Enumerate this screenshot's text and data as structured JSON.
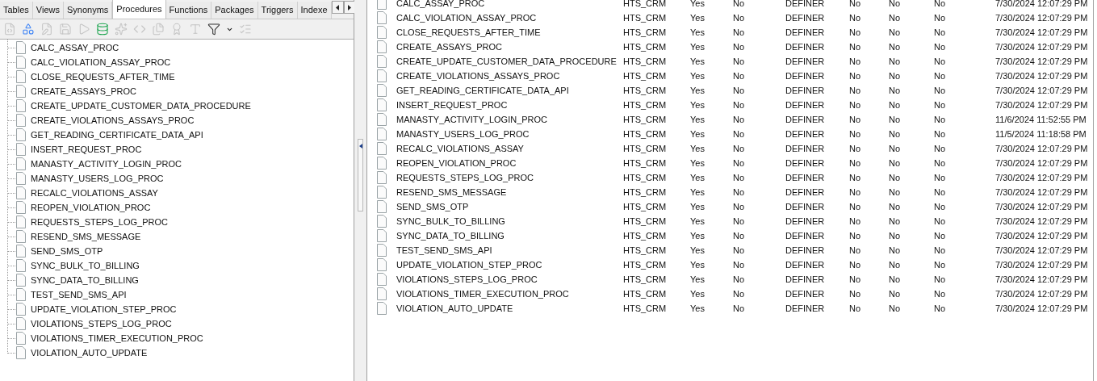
{
  "tabs": [
    {
      "label": "Tables",
      "selected": false
    },
    {
      "label": "Views",
      "selected": false
    },
    {
      "label": "Synonyms",
      "selected": false
    },
    {
      "label": "Procedures",
      "selected": true
    },
    {
      "label": "Functions",
      "selected": false
    },
    {
      "label": "Packages",
      "selected": false
    },
    {
      "label": "Triggers",
      "selected": false
    },
    {
      "label": "Indexe",
      "selected": false
    }
  ],
  "toolbar": [
    {
      "kind": "code",
      "disabled": true
    },
    {
      "kind": "shapes",
      "disabled": false
    },
    {
      "kind": "edit",
      "disabled": true
    },
    {
      "kind": "save",
      "disabled": true
    },
    {
      "kind": "play",
      "disabled": true
    },
    {
      "kind": "run",
      "disabled": false
    },
    {
      "kind": "sparkles",
      "disabled": true
    },
    {
      "kind": "sql",
      "disabled": true
    },
    {
      "kind": "files",
      "disabled": true
    },
    {
      "kind": "award",
      "disabled": true
    },
    {
      "kind": "text",
      "disabled": true
    },
    {
      "kind": "filter",
      "disabled": false
    },
    {
      "kind": "caret",
      "disabled": false
    },
    {
      "kind": "list",
      "disabled": true
    }
  ],
  "tree": {
    "items": [
      "CALC_ASSAY_PROC",
      "CALC_VIOLATION_ASSAY_PROC",
      "CLOSE_REQUESTS_AFTER_TIME",
      "CREATE_ASSAYS_PROC",
      "CREATE_UPDATE_CUSTOMER_DATA_PROCEDURE",
      "CREATE_VIOLATIONS_ASSAYS_PROC",
      "GET_READING_CERTIFICATE_DATA_API",
      "INSERT_REQUEST_PROC",
      "MANASTY_ACTIVITY_LOGIN_PROC",
      "MANASTY_USERS_LOG_PROC",
      "RECALC_VIOLATIONS_ASSAY",
      "REOPEN_VIOLATION_PROC",
      "REQUESTS_STEPS_LOG_PROC",
      "RESEND_SMS_MESSAGE",
      "SEND_SMS_OTP",
      "SYNC_BULK_TO_BILLING",
      "SYNC_DATA_TO_BILLING",
      "TEST_SEND_SMS_API",
      "UPDATE_VIOLATION_STEP_PROC",
      "VIOLATIONS_STEPS_LOG_PROC",
      "VIOLATIONS_TIMER_EXECUTION_PROC",
      "VIOLATION_AUTO_UPDATE"
    ]
  },
  "table": {
    "rows": [
      [
        "CALC_ASSAY_PROC",
        "HTS_CRM",
        "Yes",
        "No",
        "DEFINER",
        "No",
        "No",
        "No",
        "7/30/2024 12:07:29 PM"
      ],
      [
        "CALC_VIOLATION_ASSAY_PROC",
        "HTS_CRM",
        "Yes",
        "No",
        "DEFINER",
        "No",
        "No",
        "No",
        "7/30/2024 12:07:29 PM"
      ],
      [
        "CLOSE_REQUESTS_AFTER_TIME",
        "HTS_CRM",
        "Yes",
        "No",
        "DEFINER",
        "No",
        "No",
        "No",
        "7/30/2024 12:07:29 PM"
      ],
      [
        "CREATE_ASSAYS_PROC",
        "HTS_CRM",
        "Yes",
        "No",
        "DEFINER",
        "No",
        "No",
        "No",
        "7/30/2024 12:07:29 PM"
      ],
      [
        "CREATE_UPDATE_CUSTOMER_DATA_PROCEDURE",
        "HTS_CRM",
        "Yes",
        "No",
        "DEFINER",
        "No",
        "No",
        "No",
        "7/30/2024 12:07:29 PM"
      ],
      [
        "CREATE_VIOLATIONS_ASSAYS_PROC",
        "HTS_CRM",
        "Yes",
        "No",
        "DEFINER",
        "No",
        "No",
        "No",
        "7/30/2024 12:07:29 PM"
      ],
      [
        "GET_READING_CERTIFICATE_DATA_API",
        "HTS_CRM",
        "Yes",
        "No",
        "DEFINER",
        "No",
        "No",
        "No",
        "7/30/2024 12:07:29 PM"
      ],
      [
        "INSERT_REQUEST_PROC",
        "HTS_CRM",
        "Yes",
        "No",
        "DEFINER",
        "No",
        "No",
        "No",
        "7/30/2024 12:07:29 PM"
      ],
      [
        "MANASTY_ACTIVITY_LOGIN_PROC",
        "HTS_CRM",
        "Yes",
        "No",
        "DEFINER",
        "No",
        "No",
        "No",
        "11/6/2024 11:52:55 PM"
      ],
      [
        "MANASTY_USERS_LOG_PROC",
        "HTS_CRM",
        "Yes",
        "No",
        "DEFINER",
        "No",
        "No",
        "No",
        "11/5/2024 11:18:58 PM"
      ],
      [
        "RECALC_VIOLATIONS_ASSAY",
        "HTS_CRM",
        "Yes",
        "No",
        "DEFINER",
        "No",
        "No",
        "No",
        "7/30/2024 12:07:29 PM"
      ],
      [
        "REOPEN_VIOLATION_PROC",
        "HTS_CRM",
        "Yes",
        "No",
        "DEFINER",
        "No",
        "No",
        "No",
        "7/30/2024 12:07:29 PM"
      ],
      [
        "REQUESTS_STEPS_LOG_PROC",
        "HTS_CRM",
        "Yes",
        "No",
        "DEFINER",
        "No",
        "No",
        "No",
        "7/30/2024 12:07:29 PM"
      ],
      [
        "RESEND_SMS_MESSAGE",
        "HTS_CRM",
        "Yes",
        "No",
        "DEFINER",
        "No",
        "No",
        "No",
        "7/30/2024 12:07:29 PM"
      ],
      [
        "SEND_SMS_OTP",
        "HTS_CRM",
        "Yes",
        "No",
        "DEFINER",
        "No",
        "No",
        "No",
        "7/30/2024 12:07:29 PM"
      ],
      [
        "SYNC_BULK_TO_BILLING",
        "HTS_CRM",
        "Yes",
        "No",
        "DEFINER",
        "No",
        "No",
        "No",
        "7/30/2024 12:07:29 PM"
      ],
      [
        "SYNC_DATA_TO_BILLING",
        "HTS_CRM",
        "Yes",
        "No",
        "DEFINER",
        "No",
        "No",
        "No",
        "7/30/2024 12:07:29 PM"
      ],
      [
        "TEST_SEND_SMS_API",
        "HTS_CRM",
        "Yes",
        "No",
        "DEFINER",
        "No",
        "No",
        "No",
        "7/30/2024 12:07:29 PM"
      ],
      [
        "UPDATE_VIOLATION_STEP_PROC",
        "HTS_CRM",
        "Yes",
        "No",
        "DEFINER",
        "No",
        "No",
        "No",
        "7/30/2024 12:07:29 PM"
      ],
      [
        "VIOLATIONS_STEPS_LOG_PROC",
        "HTS_CRM",
        "Yes",
        "No",
        "DEFINER",
        "No",
        "No",
        "No",
        "7/30/2024 12:07:29 PM"
      ],
      [
        "VIOLATIONS_TIMER_EXECUTION_PROC",
        "HTS_CRM",
        "Yes",
        "No",
        "DEFINER",
        "No",
        "No",
        "No",
        "7/30/2024 12:07:29 PM"
      ],
      [
        "VIOLATION_AUTO_UPDATE",
        "HTS_CRM",
        "Yes",
        "No",
        "DEFINER",
        "No",
        "No",
        "No",
        "7/30/2024 12:07:29 PM"
      ]
    ]
  }
}
